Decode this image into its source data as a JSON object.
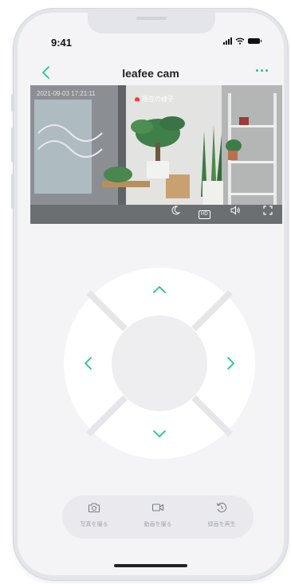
{
  "status_bar": {
    "time": "9:41"
  },
  "nav": {
    "title": "leafee cam"
  },
  "video": {
    "timestamp": "2021-09-03 17:21:11",
    "live_label": "現在の様子",
    "live_color": "#ff3b30",
    "controls": [
      "moon-icon",
      "hd-icon",
      "speaker-icon",
      "fullscreen-icon"
    ],
    "hd_text": "HD"
  },
  "dpad": {
    "arrows": [
      "chevron-up-icon",
      "chevron-down-icon",
      "chevron-left-icon",
      "chevron-right-icon"
    ],
    "accent": "#22c58b"
  },
  "actions": [
    {
      "label": "写真を撮る",
      "icon": "camera-icon"
    },
    {
      "label": "動画を撮る",
      "icon": "video-camera-icon"
    },
    {
      "label": "録画を再生",
      "icon": "replay-icon"
    }
  ]
}
